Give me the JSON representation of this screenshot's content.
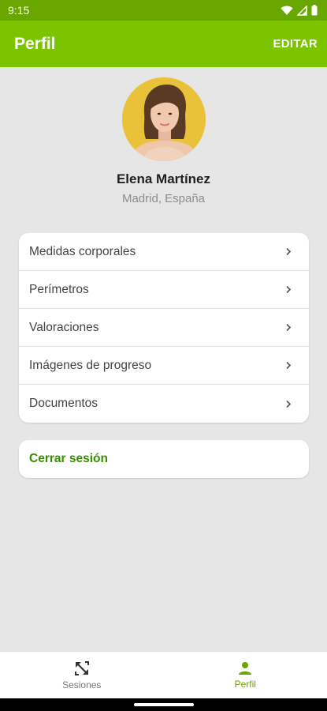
{
  "status_bar": {
    "time": "9:15",
    "icons": [
      "wifi-icon",
      "signal-icon",
      "battery-icon"
    ]
  },
  "app_bar": {
    "title": "Perfil",
    "edit_label": "EDITAR"
  },
  "profile": {
    "name": "Elena Martínez",
    "location": "Madrid, España"
  },
  "menu": {
    "items": [
      {
        "label": "Medidas corporales"
      },
      {
        "label": "Perímetros"
      },
      {
        "label": "Valoraciones"
      },
      {
        "label": "Imágenes de progreso"
      },
      {
        "label": "Documentos"
      }
    ]
  },
  "logout": {
    "label": "Cerrar sesión"
  },
  "bottom_nav": {
    "items": [
      {
        "label": "Sesiones",
        "icon": "resize-arrows-icon",
        "active": false
      },
      {
        "label": "Perfil",
        "icon": "person-icon",
        "active": true
      }
    ]
  },
  "colors": {
    "primary": "#7cc300",
    "status_bar": "#6aa600",
    "accent_text": "#3a8c00",
    "background": "#e6e6e6"
  }
}
